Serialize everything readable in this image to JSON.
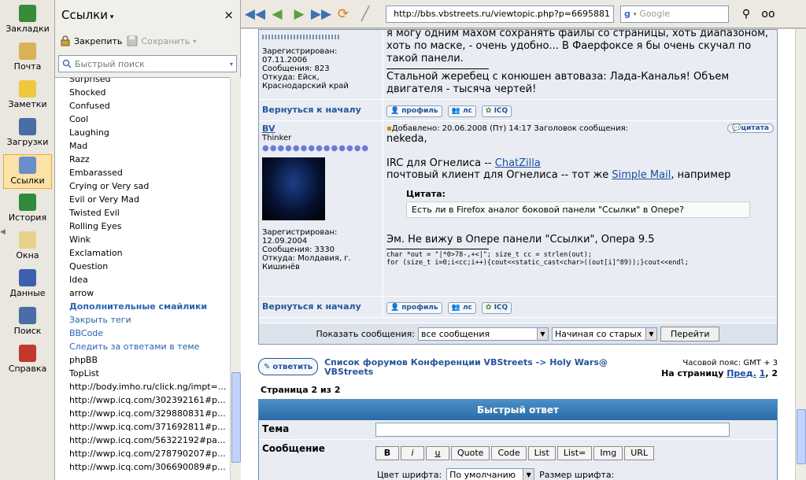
{
  "sidebar_icons": [
    {
      "label": "Закладки",
      "icon": "bookmarks-icon"
    },
    {
      "label": "Почта",
      "icon": "mail-icon"
    },
    {
      "label": "Заметки",
      "icon": "notes-icon"
    },
    {
      "label": "Загрузки",
      "icon": "downloads-icon"
    },
    {
      "label": "Ссылки",
      "icon": "links-icon",
      "active": true
    },
    {
      "label": "История",
      "icon": "history-icon"
    },
    {
      "label": "Окна",
      "icon": "windows-icon"
    },
    {
      "label": "Данные",
      "icon": "info-icon"
    },
    {
      "label": "Поиск",
      "icon": "search-icon"
    },
    {
      "label": "Справка",
      "icon": "help-icon"
    }
  ],
  "links_panel": {
    "title": "Ссылки",
    "close": "×",
    "pin_label": "Закрепить",
    "save_label": "Сохранить",
    "search_placeholder": "Быстрый поиск",
    "items": [
      {
        "text": "Surprised",
        "style": ""
      },
      {
        "text": "Shocked",
        "style": ""
      },
      {
        "text": "Confused",
        "style": ""
      },
      {
        "text": "Cool",
        "style": ""
      },
      {
        "text": "Laughing",
        "style": ""
      },
      {
        "text": "Mad",
        "style": ""
      },
      {
        "text": "Razz",
        "style": ""
      },
      {
        "text": "Embarassed",
        "style": ""
      },
      {
        "text": "Crying or Very sad",
        "style": ""
      },
      {
        "text": "Evil or Very Mad",
        "style": ""
      },
      {
        "text": "Twisted Evil",
        "style": ""
      },
      {
        "text": "Rolling Eyes",
        "style": ""
      },
      {
        "text": "Wink",
        "style": ""
      },
      {
        "text": "Exclamation",
        "style": ""
      },
      {
        "text": "Question",
        "style": ""
      },
      {
        "text": "Idea",
        "style": ""
      },
      {
        "text": "arrow",
        "style": ""
      },
      {
        "text": "Дополнительные смайлики",
        "style": "blue bold"
      },
      {
        "text": "Закрыть теги",
        "style": "blue"
      },
      {
        "text": "BBCode",
        "style": "blue"
      },
      {
        "text": "Следить за ответами в теме",
        "style": "blue"
      },
      {
        "text": "phpBB",
        "style": ""
      },
      {
        "text": "TopList",
        "style": ""
      },
      {
        "text": "http://body.imho.ru/click.ng/impt=...",
        "style": ""
      },
      {
        "text": "http://wwp.icq.com/302392161#p...",
        "style": ""
      },
      {
        "text": "http://wwp.icq.com/329880831#p...",
        "style": ""
      },
      {
        "text": "http://wwp.icq.com/371692811#p...",
        "style": ""
      },
      {
        "text": "http://wwp.icq.com/56322192#pa...",
        "style": ""
      },
      {
        "text": "http://wwp.icq.com/278790207#p...",
        "style": ""
      },
      {
        "text": "http://wwp.icq.com/306690089#p...",
        "style": ""
      }
    ]
  },
  "toolbar": {
    "url": "http://bbs.vbstreets.ru/viewtopic.php?p=6695881",
    "search_placeholder": "Google"
  },
  "post1": {
    "registered": "Зарегистрирован: 07.11.2006",
    "messages": "Сообщения: 823",
    "from": "Откуда: Ейск, Краснодарский край",
    "text1": "я могу одним махом сохранять файлы со страницы, хоть диапазоном, хоть по маске, - очень удобно... В Фаерфоксе я бы очень скучал по такой панели.",
    "sig": "Стальной жеребец с конюшен автоваза: Лада-Каналья! Объем двигателя - тысяча чертей!",
    "back": "Вернуться к началу"
  },
  "buttons": {
    "profile": "профиль",
    "pm": "лс",
    "icq": "ICQ",
    "quote": "цитата"
  },
  "post2": {
    "author": "BV",
    "rank": "Thinker",
    "stars": "●●●●●●●●●●●●●●",
    "registered": "Зарегистрирован: 12.09.2004",
    "messages": "Сообщения: 3330",
    "from": "Откуда: Молдавия, г. Кишинёв",
    "header": "Добавлено: 20.06.2008 (Пт) 14:17    Заголовок сообщения:",
    "greeting": "nekeda,",
    "irc_prefix": "IRC для Огнелиса -- ",
    "irc_link": "ChatZilla",
    "mail_prefix": "почтовый клиент для Огнелиса -- тот же ",
    "mail_link": "Simple Mail",
    "mail_suffix": ", например",
    "quote_title": "Цитата:",
    "quote_text": "Есть ли в Firefox аналог боковой панели \"Ссылки\" в Опере?",
    "answer": "Эм. Не вижу в Опере панели \"Ссылки\", Опера 9.5",
    "code1": "char *out = \"|*0>78-,+<|\"; size_t cc = strlen(out);",
    "code2": "for (size_t i=0;i<cc;i++){cout<<static_cast<char>((out[i]^89));}cout<<endl;",
    "back": "Вернуться к началу"
  },
  "showbar": {
    "label": "Показать сообщения:",
    "select1": "все сообщения",
    "select2": "Начиная со старых",
    "go": "Перейти"
  },
  "nav": {
    "reply": "ответить",
    "crumb": "Список форумов Конференции VBStreets -> Holy Wars@ VBStreets",
    "tz": "Часовой пояс: GMT + 3",
    "page_label": "На страницу",
    "prev": "Пред.",
    "p1": "1",
    "p2": "2",
    "pageof": "Страница 2 из 2"
  },
  "quick_reply": {
    "title": "Быстрый ответ",
    "topic_label": "Тема",
    "message_label": "Сообщение",
    "format_buttons": [
      "B",
      "i",
      "u",
      "Quote",
      "Code",
      "List",
      "List=",
      "Img",
      "URL"
    ],
    "font_color_label": "Цвет шрифта:",
    "font_color_value": "По умолчанию",
    "font_size_label": "Размер шрифта:"
  }
}
